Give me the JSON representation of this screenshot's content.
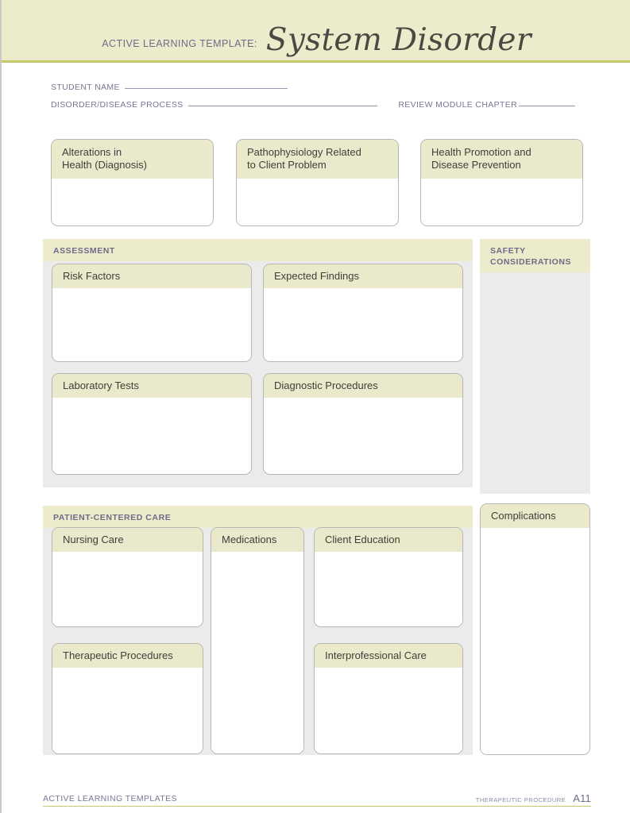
{
  "header": {
    "kicker": "ACTIVE LEARNING TEMPLATE:",
    "title": "System Disorder",
    "band_color": "#ececcc",
    "rule_color": "#c8c76a",
    "title_color": "#4b4a42"
  },
  "meta": {
    "student_name_label": "STUDENT NAME",
    "disorder_label": "DISORDER/DISEASE PROCESS",
    "review_module_label": "REVIEW MODULE CHAPTER",
    "student_name_value": "",
    "disorder_value": "",
    "review_module_value": "",
    "label_color": "#7b7594"
  },
  "top_boxes": [
    {
      "title": "Alterations in\nHealth (Diagnosis)",
      "body": ""
    },
    {
      "title": "Pathophysiology Related\nto Client Problem",
      "body": ""
    },
    {
      "title": "Health Promotion and\nDisease Prevention",
      "body": ""
    }
  ],
  "assessment": {
    "section_label": "ASSESSMENT",
    "panel_color": "#ebebeb",
    "cards": [
      {
        "title": "Risk Factors",
        "body": ""
      },
      {
        "title": "Expected Findings",
        "body": ""
      },
      {
        "title": "Laboratory Tests",
        "body": ""
      },
      {
        "title": "Diagnostic Procedures",
        "body": ""
      }
    ]
  },
  "safety": {
    "section_label": "SAFETY\nCONSIDERATIONS",
    "body": ""
  },
  "complications": {
    "title": "Complications",
    "body": ""
  },
  "patient_centered_care": {
    "section_label": "PATIENT-CENTERED CARE",
    "cards": [
      {
        "title": "Nursing Care",
        "body": ""
      },
      {
        "title": "Medications",
        "body": ""
      },
      {
        "title": "Client Education",
        "body": ""
      },
      {
        "title": "Therapeutic Procedures",
        "body": ""
      },
      {
        "title": "Interprofessional Care",
        "body": ""
      }
    ]
  },
  "footer": {
    "left": "ACTIVE LEARNING TEMPLATES",
    "category": "THERAPEUTIC PROCEDURE",
    "page": "A11",
    "rule_color": "#c8c76a"
  }
}
